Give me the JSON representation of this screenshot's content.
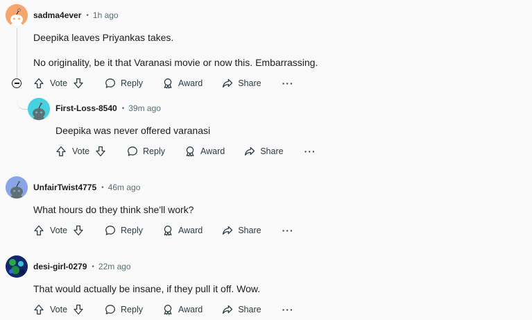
{
  "comments": [
    {
      "username": "sadma4ever",
      "time": "1h ago",
      "paragraphs": [
        "Deepika leaves Priyankas takes.",
        "No originality, be it that Varanasi movie or now this. Embarrassing."
      ],
      "avatar_color": "#f6a56c"
    },
    {
      "username": "First-Loss-8540",
      "time": "39m ago",
      "paragraphs": [
        "Deepika was never offered varanasi"
      ],
      "avatar_color": "#46d1e0"
    },
    {
      "username": "UnfairTwist4775",
      "time": "46m ago",
      "paragraphs": [
        "What hours do they think she'll work?"
      ],
      "avatar_color": "#8aa4e8"
    },
    {
      "username": "desi-girl-0279",
      "time": "22m ago",
      "paragraphs": [
        "That would actually be insane, if they pull it off. Wow."
      ],
      "avatar_color": "#1f3a8a"
    }
  ],
  "actions": {
    "vote": "Vote",
    "reply": "Reply",
    "award": "Award",
    "share": "Share",
    "more": "···"
  },
  "separator": "•"
}
